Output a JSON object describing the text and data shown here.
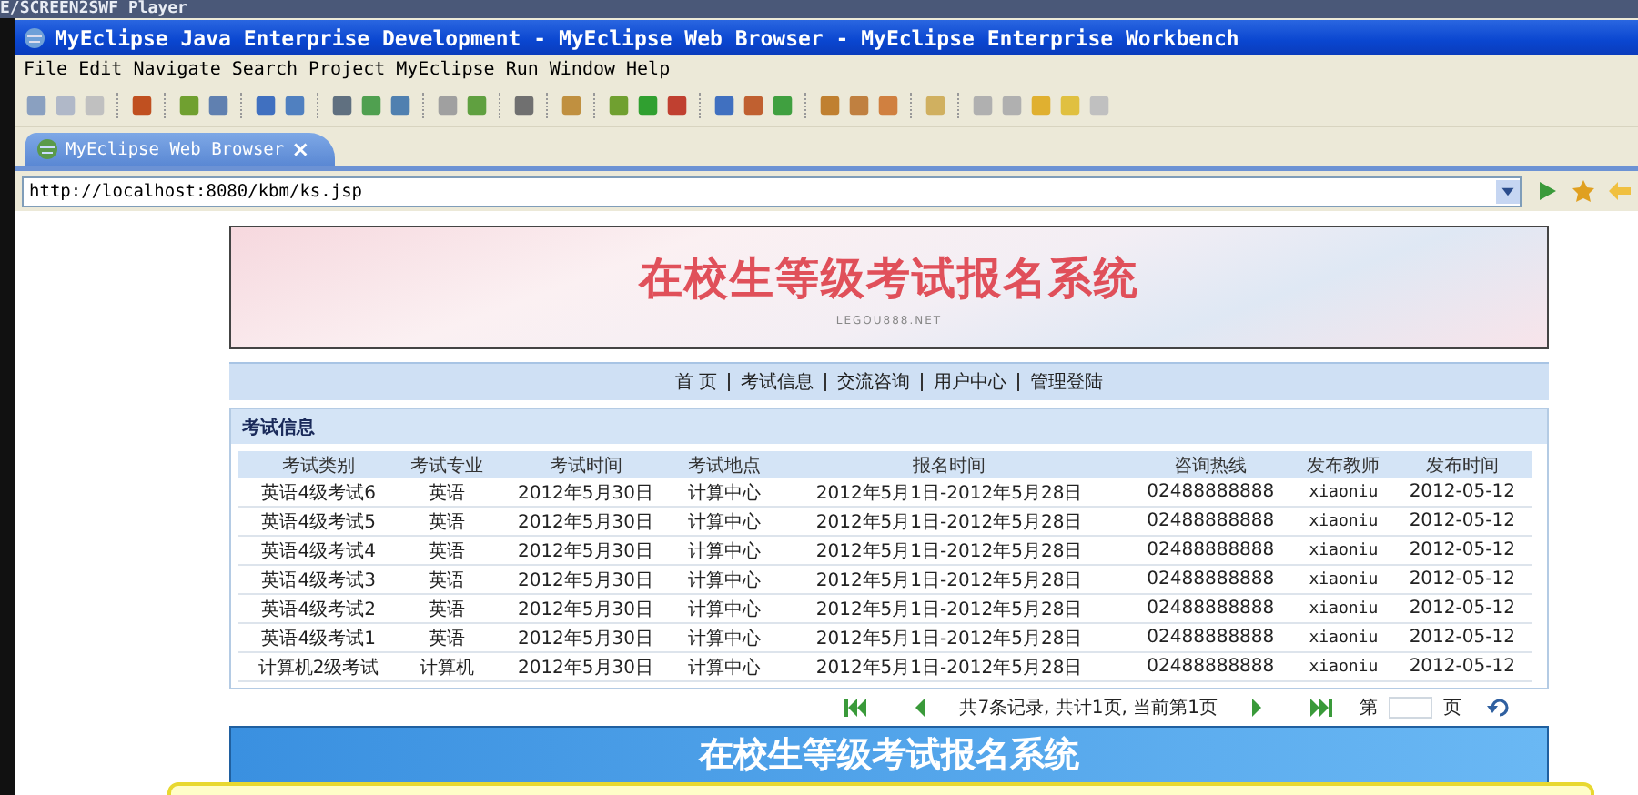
{
  "player_bar": {
    "title": "E/SCREEN2SWF Player"
  },
  "window": {
    "title": "MyEclipse Java Enterprise Development - MyEclipse Web Browser - MyEclipse Enterprise Workbench"
  },
  "menu": [
    "File",
    "Edit",
    "Navigate",
    "Search",
    "Project",
    "MyEclipse",
    "Run",
    "Window",
    "Help"
  ],
  "editor_tab": {
    "label": "MyEclipse Web Browser",
    "close": "×"
  },
  "address_bar": {
    "value": "http://localhost:8080/kbm/ks.jsp"
  },
  "banner": {
    "title": "在校生等级考试报名系统",
    "subtitle": "LEGOU888.NET"
  },
  "nav": [
    "首 页",
    "考试信息",
    "交流咨询",
    "用户中心",
    "管理登陆"
  ],
  "panel": {
    "title": "考试信息"
  },
  "table": {
    "columns": [
      "考试类别",
      "考试专业",
      "考试时间",
      "考试地点",
      "报名时间",
      "咨询热线",
      "发布教师",
      "发布时间"
    ],
    "rows": [
      [
        "英语4级考试6",
        "英语",
        "2012年5月30日",
        "计算中心",
        "2012年5月1日-2012年5月28日",
        "02488888888",
        "xiaoniu",
        "2012-05-12"
      ],
      [
        "英语4级考试5",
        "英语",
        "2012年5月30日",
        "计算中心",
        "2012年5月1日-2012年5月28日",
        "02488888888",
        "xiaoniu",
        "2012-05-12"
      ],
      [
        "英语4级考试4",
        "英语",
        "2012年5月30日",
        "计算中心",
        "2012年5月1日-2012年5月28日",
        "02488888888",
        "xiaoniu",
        "2012-05-12"
      ],
      [
        "英语4级考试3",
        "英语",
        "2012年5月30日",
        "计算中心",
        "2012年5月1日-2012年5月28日",
        "02488888888",
        "xiaoniu",
        "2012-05-12"
      ],
      [
        "英语4级考试2",
        "英语",
        "2012年5月30日",
        "计算中心",
        "2012年5月1日-2012年5月28日",
        "02488888888",
        "xiaoniu",
        "2012-05-12"
      ],
      [
        "英语4级考试1",
        "英语",
        "2012年5月30日",
        "计算中心",
        "2012年5月1日-2012年5月28日",
        "02488888888",
        "xiaoniu",
        "2012-05-12"
      ],
      [
        "计算机2级考试",
        "计算机",
        "2012年5月30日",
        "计算中心",
        "2012年5月1日-2012年5月28日",
        "02488888888",
        "xiaoniu",
        "2012-05-12"
      ]
    ]
  },
  "pager": {
    "summary": "共7条记录, 共计1页, 当前第1页",
    "page_label": "第",
    "page_suffix": "页"
  },
  "footer_banner": {
    "title": "在校生等级考试报名系统"
  }
}
